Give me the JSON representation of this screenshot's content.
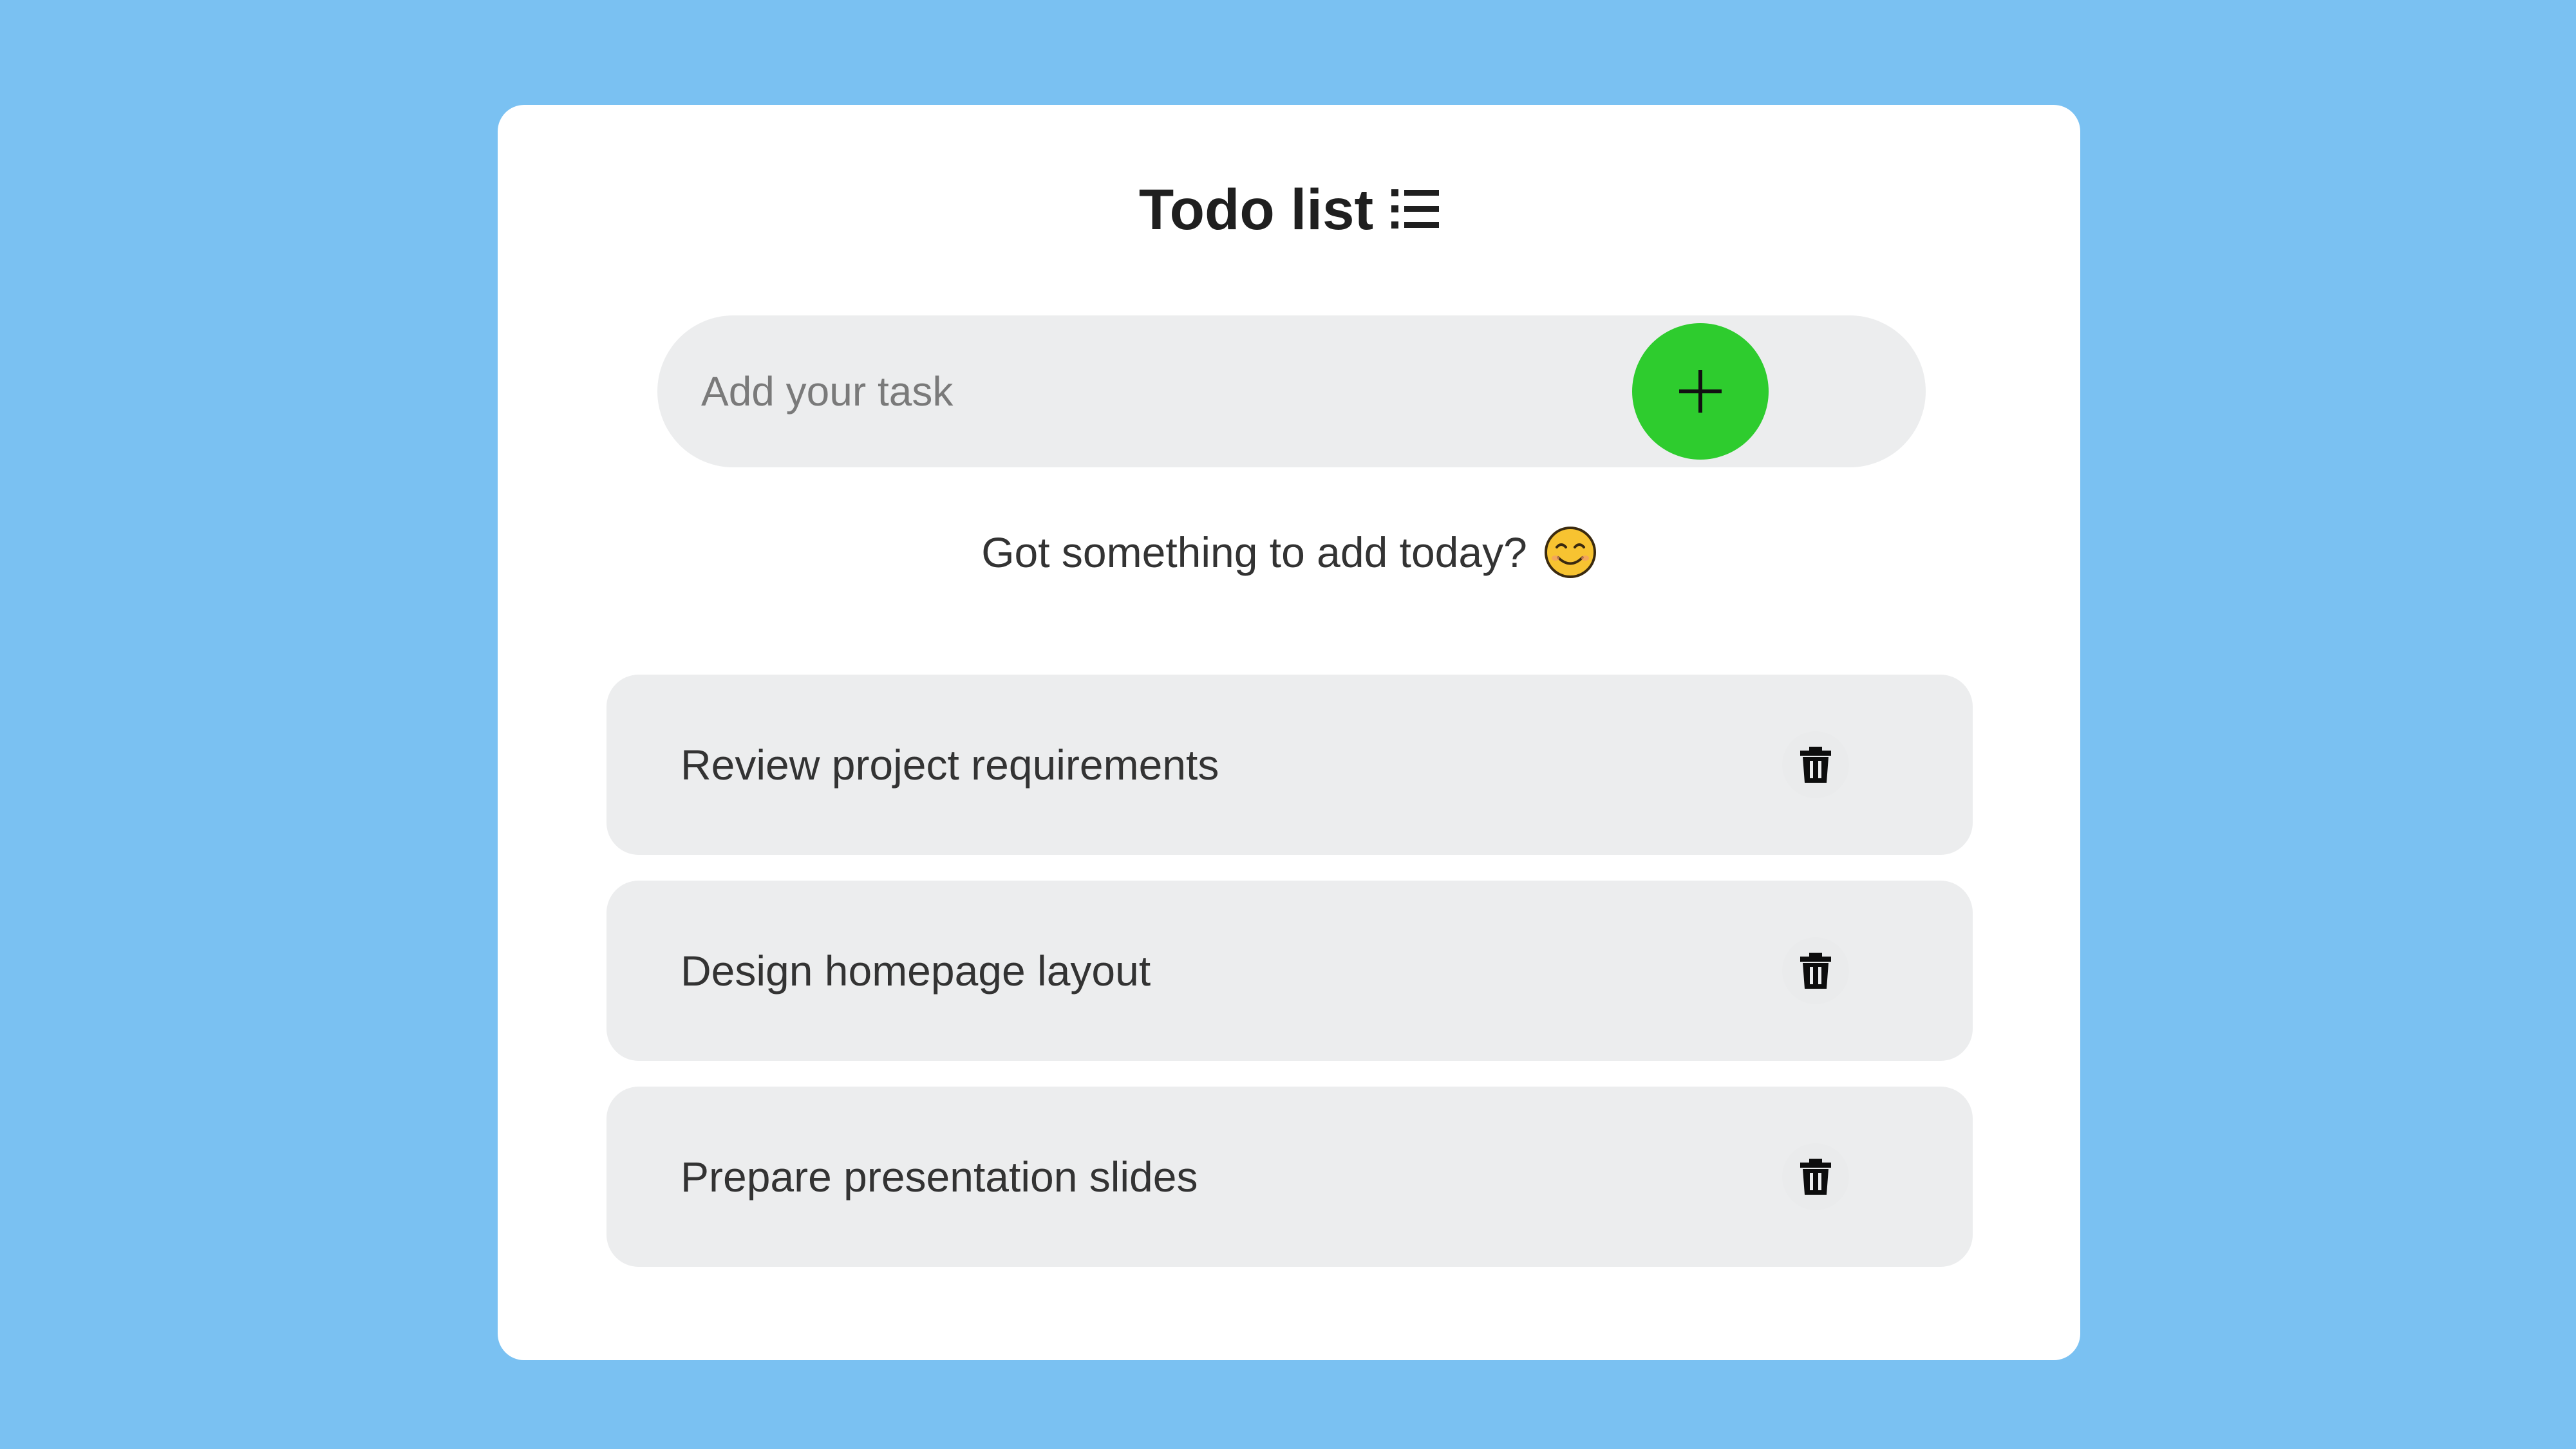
{
  "header": {
    "title": "Todo list",
    "title_icon": "list-icon"
  },
  "add_task": {
    "placeholder": "Add your task",
    "value": "",
    "button_icon": "plus-icon",
    "button_color": "#2ecc2e"
  },
  "hint": {
    "text": "Got something to add today?",
    "icon": "smiling-face-icon"
  },
  "tasks": [
    {
      "label": "Review project requirements",
      "action_icon": "trash-icon"
    },
    {
      "label": "Design homepage layout",
      "action_icon": "trash-icon"
    },
    {
      "label": "Prepare presentation slides",
      "action_icon": "trash-icon"
    }
  ],
  "colors": {
    "background": "#7ac1f2",
    "card": "#ffffff",
    "field": "#ecedee",
    "accent": "#2ecc2e",
    "text": "#333333",
    "title": "#1f1f1f"
  }
}
